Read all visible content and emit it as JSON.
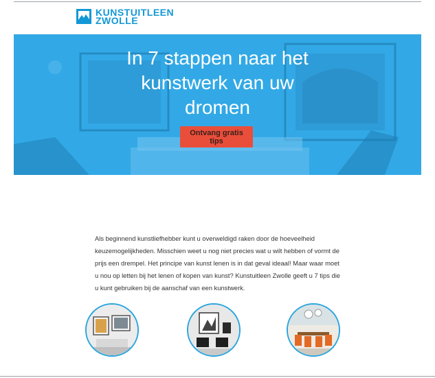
{
  "logo": {
    "line1": "KUNSTUITLEEN",
    "line2": "ZWOLLE",
    "icon": "framed-landscape-icon",
    "color": "#1298d6"
  },
  "hero": {
    "title_lines": [
      "In 7 stappen naar het",
      "kunstwerk van uw",
      "dromen"
    ],
    "cta_label": "Ontvang gratis tips",
    "overlay_color": "#32a9e6",
    "cta_color": "#e94e3a"
  },
  "intro": {
    "text": "Als beginnend kunstliefhebber kunt u overweldigd raken door de hoeveelheid keuzemogelijkheden. Misschien weet u nog niet precies wat u wilt hebben of vormt de prijs een drempel. Het principe van kunst lenen is in dat geval ideaal! Maar waar moet u nou op letten bij het lenen of kopen van kunst? Kunstuitleen Zwolle geeft u 7 tips die u kunt gebruiken bij de aanschaf van een kunstwerk."
  },
  "thumbnails": [
    {
      "icon": "living-room-art-photo"
    },
    {
      "icon": "gallery-room-photo"
    },
    {
      "icon": "dining-room-photo"
    }
  ],
  "accent": "#2aa5dd"
}
